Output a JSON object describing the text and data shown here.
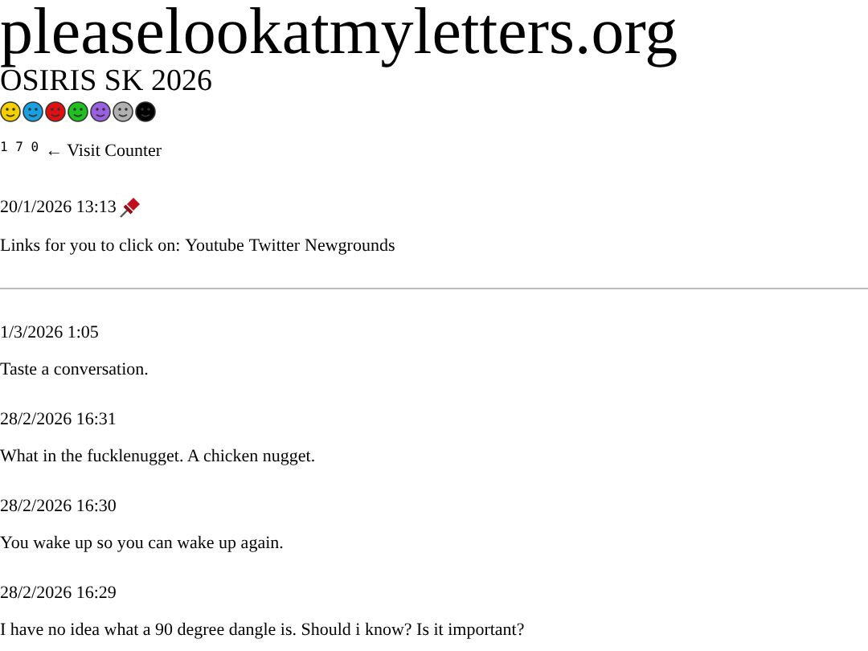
{
  "site_title": "pleaselookatmyletters.org",
  "subtitle": "OSIRIS SK 2026",
  "smileys": [
    {
      "color": "#f5d000"
    },
    {
      "color": "#1aa0e0"
    },
    {
      "color": "#e01010"
    },
    {
      "color": "#20c020"
    },
    {
      "color": "#9a60e0"
    },
    {
      "color": "#b0b0b0"
    },
    {
      "color": "#000000"
    }
  ],
  "visit_counter": {
    "digits": "1 7 0",
    "label": "← Visit Counter"
  },
  "pinned_post": {
    "date": "20/1/2026 13:13",
    "text": "Links for you to click on:",
    "links": [
      "Youtube",
      "Twitter",
      "Newgrounds"
    ]
  },
  "posts": [
    {
      "date": "1/3/2026 1:05",
      "text": "Taste a conversation."
    },
    {
      "date": "28/2/2026 16:31",
      "text": "What in the fucklenugget. A chicken nugget."
    },
    {
      "date": "28/2/2026 16:30",
      "text": "You wake up so you can wake up again."
    },
    {
      "date": "28/2/2026 16:29",
      "text": "I have no idea what a 90 degree dangle is. Should i know? Is it important?"
    }
  ]
}
